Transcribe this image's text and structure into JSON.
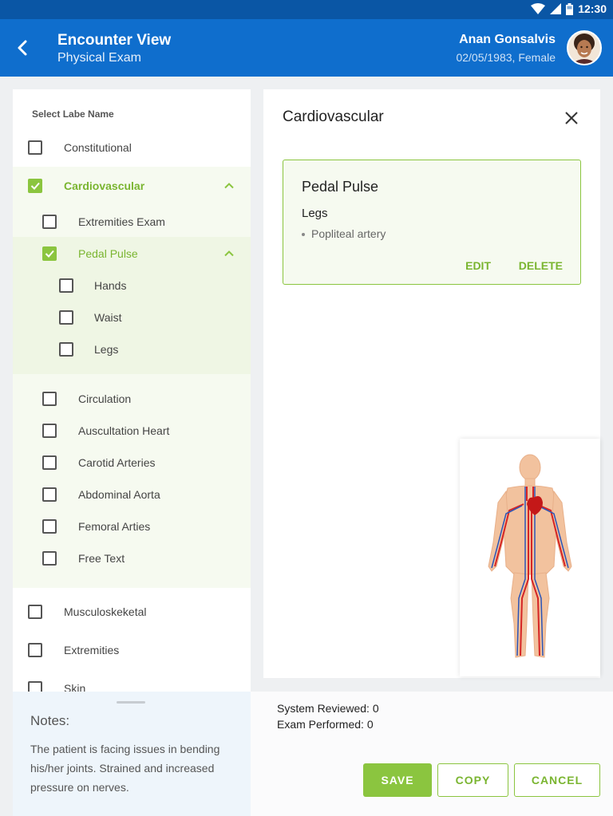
{
  "status_bar": {
    "time": "12:30",
    "icons": [
      "wifi-icon",
      "signal-icon",
      "battery-icon"
    ]
  },
  "header": {
    "title": "Encounter View",
    "subtitle": "Physical Exam",
    "patient_name": "Anan Gonsalvis",
    "patient_info": "02/05/1983, Female"
  },
  "left_panel": {
    "title": "Select Labe Name",
    "items": {
      "constitutional": "Constitutional",
      "cardiovascular": "Cardiovascular",
      "extremities_exam": "Extremities Exam",
      "pedal_pulse": "Pedal Pulse",
      "hands": "Hands",
      "waist": "Waist",
      "legs": "Legs",
      "circulation": "Circulation",
      "auscultation_heart": "Auscultation Heart",
      "carotid_arteries": "Carotid Arteries",
      "abdominal_aorta": "Abdominal Aorta",
      "femoral_arties": "Femoral Arties",
      "free_text": "Free Text",
      "musculoskeletal": "Musculoskeketal",
      "extremities": "Extremities",
      "skin": "Skin"
    }
  },
  "notes": {
    "title": "Notes:",
    "text": "The patient is facing issues in bending his/her joints. Strained and increased pressure on nerves."
  },
  "right_panel": {
    "title": "Cardiovascular",
    "card": {
      "title": "Pedal Pulse",
      "subtitle": "Legs",
      "bullet": "Popliteal artery",
      "edit_label": "EDIT",
      "delete_label": "DELETE"
    }
  },
  "footer": {
    "system_reviewed": "System Reviewed: 0",
    "exam_performed": "Exam Performed: 0",
    "save_label": "SAVE",
    "copy_label": "COPY",
    "cancel_label": "CANCEL"
  },
  "colors": {
    "header_blue": "#0f6ecd",
    "status_blue": "#0a56a5",
    "accent_green": "#8bc53f"
  }
}
